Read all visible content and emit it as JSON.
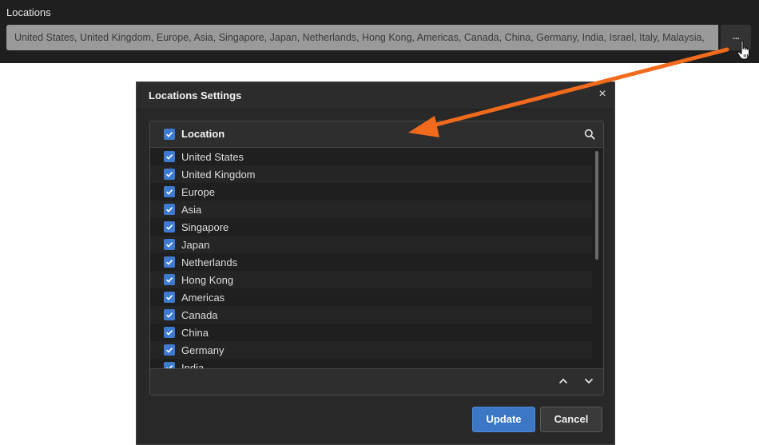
{
  "top": {
    "label": "Locations",
    "value": "United States, United Kingdom, Europe, Asia, Singapore, Japan, Netherlands, Hong Kong, Americas, Canada, China, Germany, India, Israel, Italy, Malaysia,",
    "more_label": "..."
  },
  "dialog": {
    "title": "Locations Settings",
    "close_label": "×",
    "column_header": "Location",
    "items": [
      {
        "label": "United States",
        "checked": true
      },
      {
        "label": "United Kingdom",
        "checked": true
      },
      {
        "label": "Europe",
        "checked": true
      },
      {
        "label": "Asia",
        "checked": true
      },
      {
        "label": "Singapore",
        "checked": true
      },
      {
        "label": "Japan",
        "checked": true
      },
      {
        "label": "Netherlands",
        "checked": true
      },
      {
        "label": "Hong Kong",
        "checked": true
      },
      {
        "label": "Americas",
        "checked": true
      },
      {
        "label": "Canada",
        "checked": true
      },
      {
        "label": "China",
        "checked": true
      },
      {
        "label": "Germany",
        "checked": true
      },
      {
        "label": "India",
        "checked": true
      }
    ],
    "update_label": "Update",
    "cancel_label": "Cancel"
  },
  "colors": {
    "accent": "#3b77c4",
    "annotation_arrow": "#f26b1d"
  },
  "icons": {
    "search": "search-icon",
    "close": "close-icon",
    "check": "check-icon",
    "scroll_up": "chevron-up-icon",
    "scroll_down": "chevron-down-icon",
    "cursor": "hand-cursor-icon"
  }
}
